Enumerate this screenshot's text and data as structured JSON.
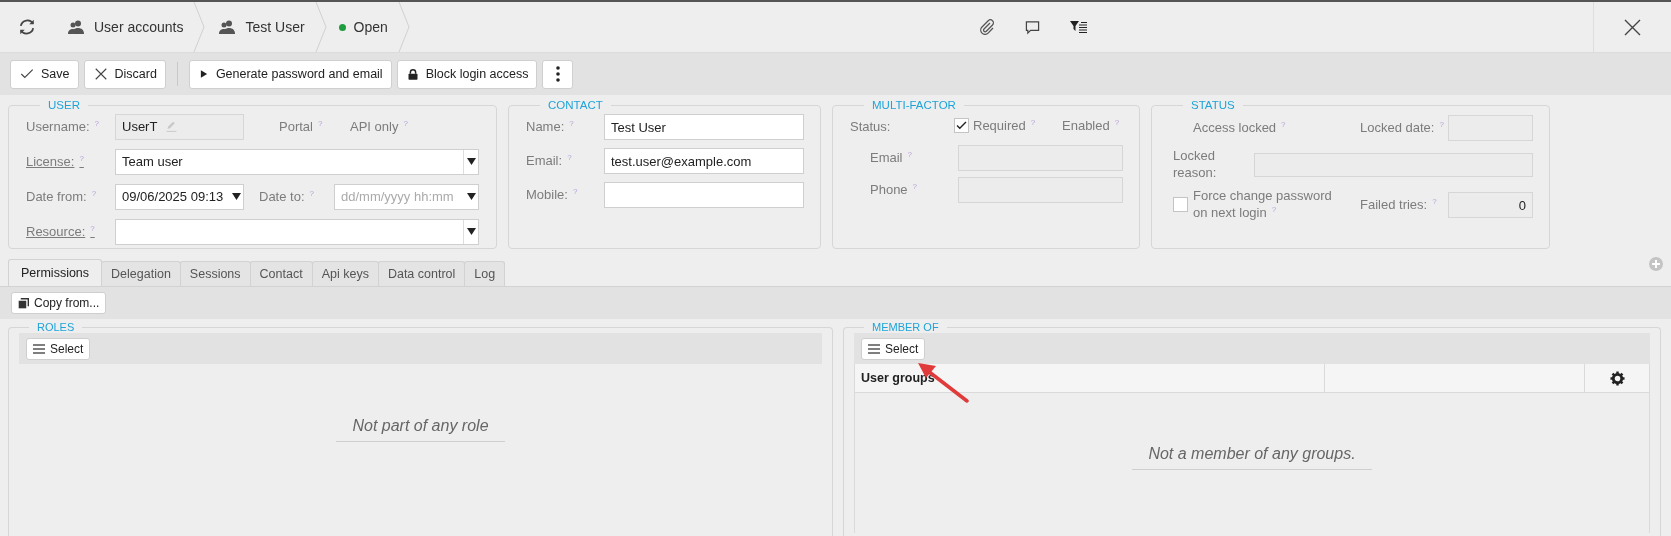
{
  "breadcrumbs": [
    {
      "label": "User accounts",
      "kind": "users"
    },
    {
      "label": "Test User",
      "kind": "user"
    },
    {
      "label": "Open",
      "kind": "status",
      "color": "#1e9e3e"
    }
  ],
  "toolbar": [
    {
      "label": "Save",
      "kind": "check"
    },
    {
      "label": "Discard",
      "kind": "cross"
    },
    {
      "kind": "separator"
    },
    {
      "label": "Generate password and email",
      "kind": "play"
    },
    {
      "label": "Block login access",
      "kind": "lock"
    },
    {
      "kind": "more"
    }
  ],
  "user_section": {
    "title": "USER",
    "username": {
      "label": "Username:",
      "help": "?",
      "value": "UserT"
    },
    "portal": {
      "label": "Portal",
      "help": "?"
    },
    "api_only": {
      "label": "API only",
      "help": "?"
    },
    "license": {
      "label": "License:",
      "help": "?",
      "value": "Team user",
      "link": true
    },
    "date_from": {
      "label": "Date from:",
      "help": "?",
      "value": "09/06/2025 09:13"
    },
    "date_to": {
      "label": "Date to:",
      "help": "?",
      "placeholder": "dd/mm/yyyy hh:mm"
    },
    "resource": {
      "label": "Resource:",
      "help": "?",
      "link": true
    }
  },
  "contact_section": {
    "title": "CONTACT",
    "fields": [
      {
        "label": "Name:",
        "help": "?",
        "value": "Test User"
      },
      {
        "label": "Email:",
        "help": "?",
        "value": "test.user@example.com"
      },
      {
        "label": "Mobile:",
        "help": "?"
      }
    ]
  },
  "mfa_section": {
    "title": "MULTI-FACTOR",
    "status": {
      "label": "Status:"
    },
    "required": {
      "label": "Required",
      "help": "?",
      "checked": true
    },
    "enabled": {
      "label": "Enabled",
      "help": "?"
    },
    "email": {
      "label": "Email",
      "help": "?"
    },
    "phone": {
      "label": "Phone",
      "help": "?"
    }
  },
  "status_section": {
    "title": "STATUS",
    "access_locked": {
      "label": "Access locked",
      "help": "?"
    },
    "locked_date": {
      "label": "Locked date:",
      "help": "?"
    },
    "locked_reason": {
      "label": "Locked reason:"
    },
    "force_change": {
      "label": "Force change password on next login",
      "help": "?",
      "checked": false
    },
    "failed_tries": {
      "label": "Failed tries:",
      "help": "?",
      "value": "0"
    }
  },
  "tabs": [
    {
      "label": "Permissions",
      "selected": true
    },
    {
      "label": "Delegation",
      "selected": false
    },
    {
      "label": "Sessions",
      "selected": false
    },
    {
      "label": "Contact",
      "selected": false
    },
    {
      "label": "Api keys",
      "selected": false
    },
    {
      "label": "Data control",
      "selected": false
    },
    {
      "label": "Log",
      "selected": false
    }
  ],
  "copy_button": "Copy from...",
  "roles": {
    "title": "ROLES",
    "select_button": "Select",
    "empty_text": "Not part of any role"
  },
  "member_of": {
    "title": "MEMBER OF",
    "select_button": "Select",
    "columns": [
      "User groups"
    ],
    "empty_text": "Not a member of any groups."
  }
}
